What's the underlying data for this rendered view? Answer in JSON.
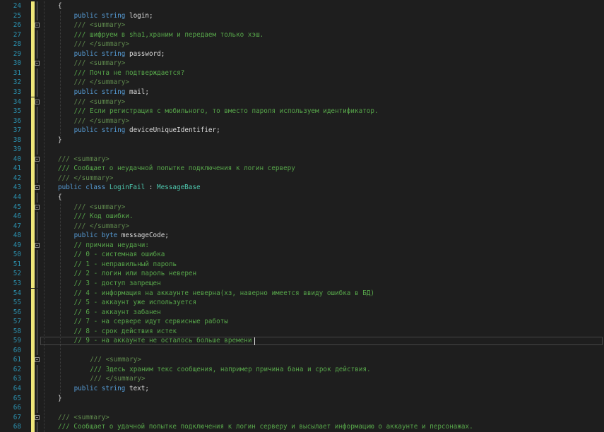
{
  "editor": {
    "lines": [
      {
        "n": "24",
        "fold": "",
        "indent": 0,
        "segs": [
          {
            "t": "tx",
            "v": "{"
          }
        ]
      },
      {
        "n": "25",
        "fold": "",
        "indent": 1,
        "segs": [
          {
            "t": "kw",
            "v": "public"
          },
          {
            "t": "tx",
            "v": " "
          },
          {
            "t": "kw",
            "v": "string"
          },
          {
            "t": "tx",
            "v": " login;"
          }
        ]
      },
      {
        "n": "26",
        "fold": "start",
        "indent": 1,
        "segs": [
          {
            "t": "xd",
            "v": "/// <summary>"
          }
        ]
      },
      {
        "n": "27",
        "fold": "",
        "indent": 1,
        "segs": [
          {
            "t": "cm",
            "v": "/// шифруем в sha1,храним и передаем только хэш."
          }
        ]
      },
      {
        "n": "28",
        "fold": "",
        "indent": 1,
        "segs": [
          {
            "t": "xd",
            "v": "/// </summary>"
          }
        ]
      },
      {
        "n": "29",
        "fold": "",
        "indent": 1,
        "segs": [
          {
            "t": "kw",
            "v": "public"
          },
          {
            "t": "tx",
            "v": " "
          },
          {
            "t": "kw",
            "v": "string"
          },
          {
            "t": "tx",
            "v": " password;"
          }
        ]
      },
      {
        "n": "30",
        "fold": "start",
        "indent": 1,
        "segs": [
          {
            "t": "xd",
            "v": "/// <summary>"
          }
        ]
      },
      {
        "n": "31",
        "fold": "",
        "indent": 1,
        "segs": [
          {
            "t": "cm",
            "v": "/// Почта не подтверждается?"
          }
        ]
      },
      {
        "n": "32",
        "fold": "",
        "indent": 1,
        "segs": [
          {
            "t": "xd",
            "v": "/// </summary>"
          }
        ]
      },
      {
        "n": "33",
        "fold": "",
        "indent": 1,
        "segs": [
          {
            "t": "kw",
            "v": "public"
          },
          {
            "t": "tx",
            "v": " "
          },
          {
            "t": "kw",
            "v": "string"
          },
          {
            "t": "tx",
            "v": " mail;"
          }
        ]
      },
      {
        "n": "34",
        "fold": "start",
        "indent": 1,
        "segs": [
          {
            "t": "xd",
            "v": "/// <summary>"
          }
        ]
      },
      {
        "n": "35",
        "fold": "",
        "indent": 1,
        "segs": [
          {
            "t": "cm",
            "v": "/// Если регистрация с мобильного, то вместо пароля используем идентификатор."
          }
        ]
      },
      {
        "n": "36",
        "fold": "",
        "indent": 1,
        "segs": [
          {
            "t": "xd",
            "v": "/// </summary>"
          }
        ]
      },
      {
        "n": "37",
        "fold": "",
        "indent": 1,
        "segs": [
          {
            "t": "kw",
            "v": "public"
          },
          {
            "t": "tx",
            "v": " "
          },
          {
            "t": "kw",
            "v": "string"
          },
          {
            "t": "tx",
            "v": " deviceUniqueIdentifier;"
          }
        ]
      },
      {
        "n": "38",
        "fold": "",
        "indent": 0,
        "segs": [
          {
            "t": "tx",
            "v": "}"
          }
        ]
      },
      {
        "n": "39",
        "fold": "",
        "indent": 0,
        "segs": []
      },
      {
        "n": "40",
        "fold": "start",
        "indent": 0,
        "segs": [
          {
            "t": "xd",
            "v": "/// <summary>"
          }
        ]
      },
      {
        "n": "41",
        "fold": "",
        "indent": 0,
        "segs": [
          {
            "t": "cm",
            "v": "/// Сообщает о неудачной попытке подключения к логин серверу"
          }
        ]
      },
      {
        "n": "42",
        "fold": "",
        "indent": 0,
        "segs": [
          {
            "t": "xd",
            "v": "/// </summary>"
          }
        ]
      },
      {
        "n": "43",
        "fold": "start",
        "indent": 0,
        "segs": [
          {
            "t": "kw",
            "v": "public"
          },
          {
            "t": "tx",
            "v": " "
          },
          {
            "t": "kw",
            "v": "class"
          },
          {
            "t": "tx",
            "v": " "
          },
          {
            "t": "ty",
            "v": "LoginFail"
          },
          {
            "t": "tx",
            "v": " : "
          },
          {
            "t": "ty",
            "v": "MessageBase"
          }
        ]
      },
      {
        "n": "44",
        "fold": "",
        "indent": 0,
        "segs": [
          {
            "t": "tx",
            "v": "{"
          }
        ]
      },
      {
        "n": "45",
        "fold": "start",
        "indent": 1,
        "segs": [
          {
            "t": "xd",
            "v": "/// <summary>"
          }
        ]
      },
      {
        "n": "46",
        "fold": "",
        "indent": 1,
        "segs": [
          {
            "t": "cm",
            "v": "/// Код ошибки."
          }
        ]
      },
      {
        "n": "47",
        "fold": "",
        "indent": 1,
        "segs": [
          {
            "t": "xd",
            "v": "/// </summary>"
          }
        ]
      },
      {
        "n": "48",
        "fold": "",
        "indent": 1,
        "segs": [
          {
            "t": "kw",
            "v": "public"
          },
          {
            "t": "tx",
            "v": " "
          },
          {
            "t": "kw",
            "v": "byte"
          },
          {
            "t": "tx",
            "v": " messageCode;"
          }
        ]
      },
      {
        "n": "49",
        "fold": "start",
        "indent": 1,
        "segs": [
          {
            "t": "cm",
            "v": "// причина неудачи:"
          }
        ]
      },
      {
        "n": "50",
        "fold": "",
        "indent": 1,
        "segs": [
          {
            "t": "cm",
            "v": "// 0 - системная ошибка"
          }
        ]
      },
      {
        "n": "51",
        "fold": "",
        "indent": 1,
        "segs": [
          {
            "t": "cm",
            "v": "// 1 - неправильный пароль"
          }
        ]
      },
      {
        "n": "52",
        "fold": "",
        "indent": 1,
        "segs": [
          {
            "t": "cm",
            "v": "// 2 - логин или пароль неверен"
          }
        ]
      },
      {
        "n": "53",
        "fold": "",
        "indent": 1,
        "segs": [
          {
            "t": "cm",
            "v": "// 3 - доступ запрещен"
          }
        ]
      },
      {
        "n": "54",
        "fold": "",
        "indent": 1,
        "segs": [
          {
            "t": "cm",
            "v": "// 4 - информация на аккаунте неверна(хз, наверно имеется ввиду ошибка в БД)"
          }
        ]
      },
      {
        "n": "55",
        "fold": "",
        "indent": 1,
        "segs": [
          {
            "t": "cm",
            "v": "// 5 - аккаунт уже используется"
          }
        ]
      },
      {
        "n": "56",
        "fold": "",
        "indent": 1,
        "segs": [
          {
            "t": "cm",
            "v": "// 6 - аккаунт забанен"
          }
        ]
      },
      {
        "n": "57",
        "fold": "",
        "indent": 1,
        "segs": [
          {
            "t": "cm",
            "v": "// 7 - на сервере идут сервисные работы"
          }
        ]
      },
      {
        "n": "58",
        "fold": "",
        "indent": 1,
        "segs": [
          {
            "t": "cm",
            "v": "// 8 - срок действия истек"
          }
        ]
      },
      {
        "n": "59",
        "fold": "",
        "indent": 1,
        "segs": [
          {
            "t": "cm",
            "v": "// 9 - на аккаунте не осталось больше времени"
          }
        ]
      },
      {
        "n": "60",
        "fold": "",
        "indent": 0,
        "segs": []
      },
      {
        "n": "61",
        "fold": "start",
        "indent": 2,
        "segs": [
          {
            "t": "xd",
            "v": "/// <summary>"
          }
        ]
      },
      {
        "n": "62",
        "fold": "",
        "indent": 2,
        "segs": [
          {
            "t": "cm",
            "v": "/// Здесь храним текс сообщения, например причина бана и срок действия."
          }
        ]
      },
      {
        "n": "63",
        "fold": "",
        "indent": 2,
        "segs": [
          {
            "t": "xd",
            "v": "/// </summary>"
          }
        ]
      },
      {
        "n": "64",
        "fold": "",
        "indent": 1,
        "segs": [
          {
            "t": "kw",
            "v": "public"
          },
          {
            "t": "tx",
            "v": " "
          },
          {
            "t": "kw",
            "v": "string"
          },
          {
            "t": "tx",
            "v": " text;"
          }
        ]
      },
      {
        "n": "65",
        "fold": "",
        "indent": 0,
        "segs": [
          {
            "t": "tx",
            "v": "}"
          }
        ]
      },
      {
        "n": "66",
        "fold": "",
        "indent": 0,
        "segs": []
      },
      {
        "n": "67",
        "fold": "start",
        "indent": 0,
        "segs": [
          {
            "t": "xd",
            "v": "/// <summary>"
          }
        ]
      },
      {
        "n": "68",
        "fold": "",
        "indent": 0,
        "segs": [
          {
            "t": "cm",
            "v": "/// Сообщает о удачной попытке подключения к логин серверу и высылает информацию о аккаунте и персонажах."
          }
        ]
      }
    ],
    "current_line": "59",
    "colors": {
      "background": "#1e1e1e",
      "line_number": "#2b91af",
      "keyword": "#569cd6",
      "comment": "#57a64a",
      "xml_doc": "#608b4e",
      "type": "#4ec9b0",
      "text": "#dcdcdc",
      "modified_bar": "#efe77a"
    }
  }
}
